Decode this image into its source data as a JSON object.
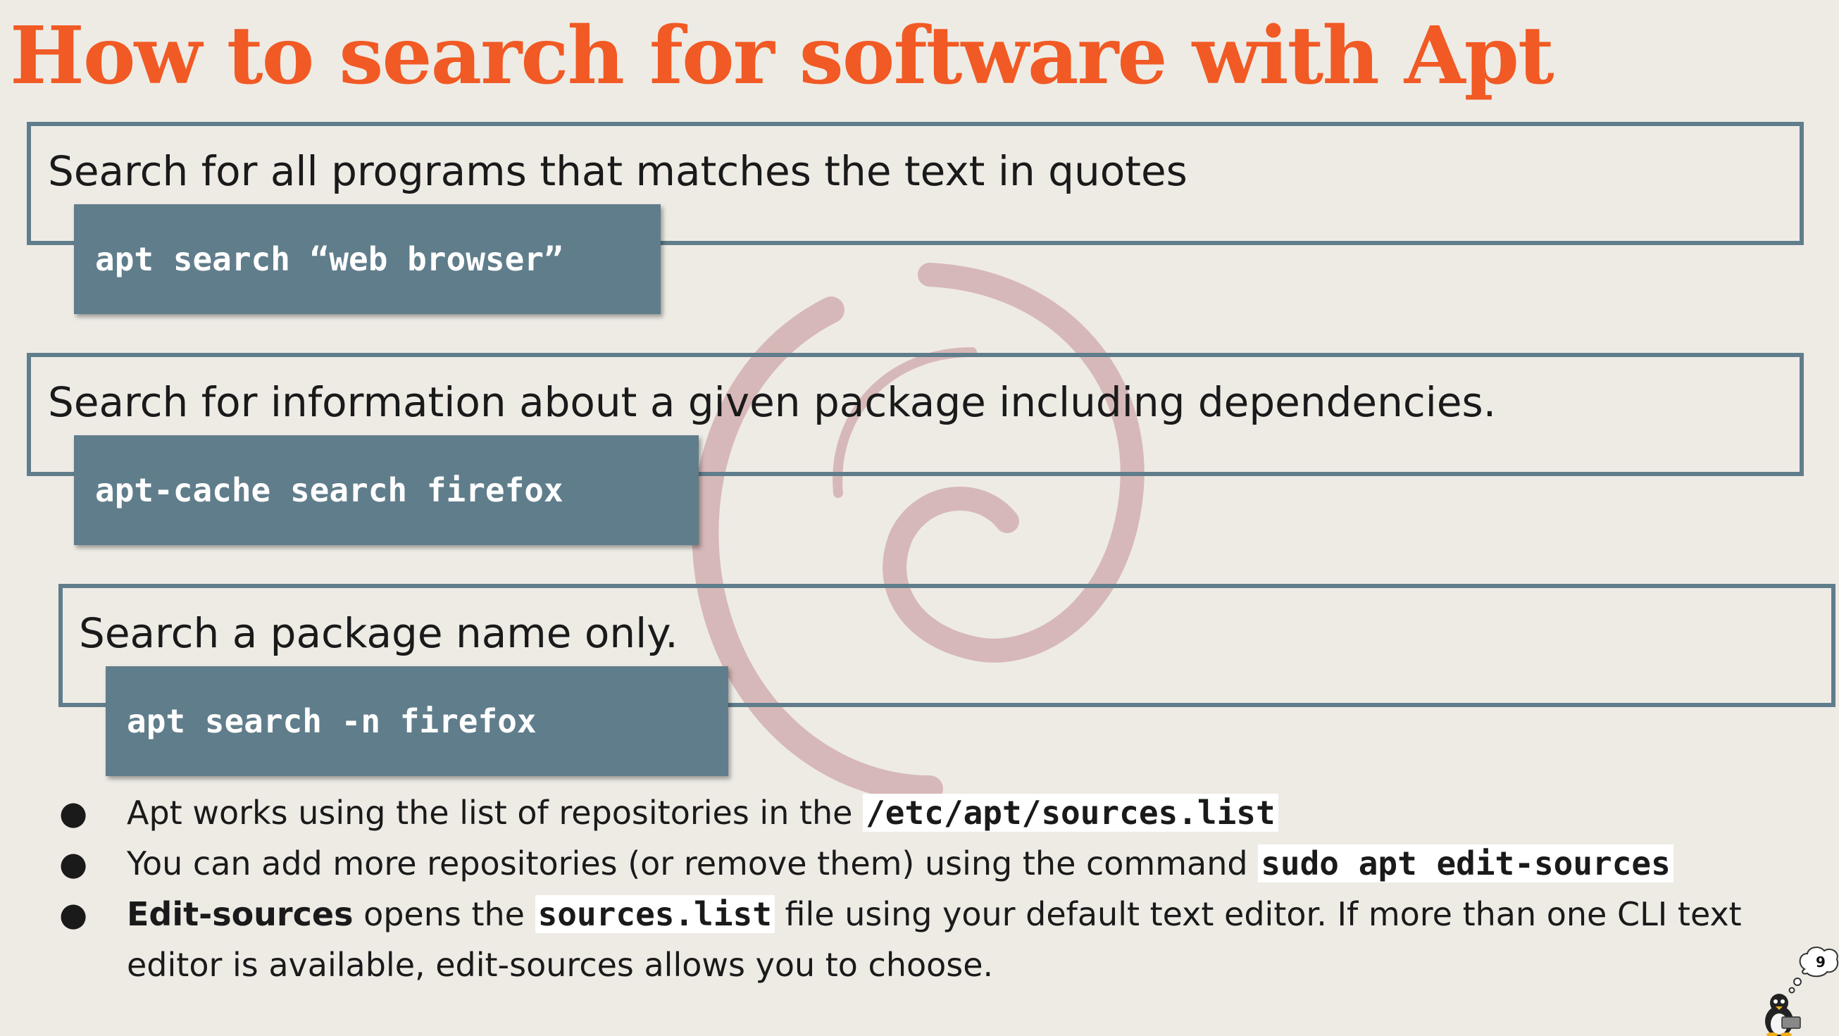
{
  "title": "How to search for software with Apt",
  "sections": [
    {
      "description": "Search for all programs that matches the text in quotes",
      "command": "apt search “web browser”"
    },
    {
      "description": "Search for information about a given package including dependencies.",
      "command": "apt-cache search firefox"
    },
    {
      "description": "Search a package name only.",
      "command": "apt search -n firefox"
    }
  ],
  "bullets": [
    {
      "text": "Apt works using the list of repositories in the ",
      "code": "/etc/apt/sources.list"
    },
    {
      "text": "You can add more repositories (or remove them) using the command ",
      "code": "sudo apt edit-sources"
    },
    {
      "bold": "Edit-sources",
      "text_a": " opens the ",
      "code": "sources.list",
      "text_b": " file using your default text editor. If more than one CLI text editor is available, edit-sources allows you to choose."
    }
  ],
  "bullet_marker": "●",
  "page_number": "9",
  "colors": {
    "title": "#F15A24",
    "accent": "#607D8B",
    "background": "#EEEBE5",
    "watermark": "#D7B8B8"
  },
  "icons": {
    "watermark": "debian-swirl-icon",
    "mascot": "tux-penguin-icon"
  }
}
